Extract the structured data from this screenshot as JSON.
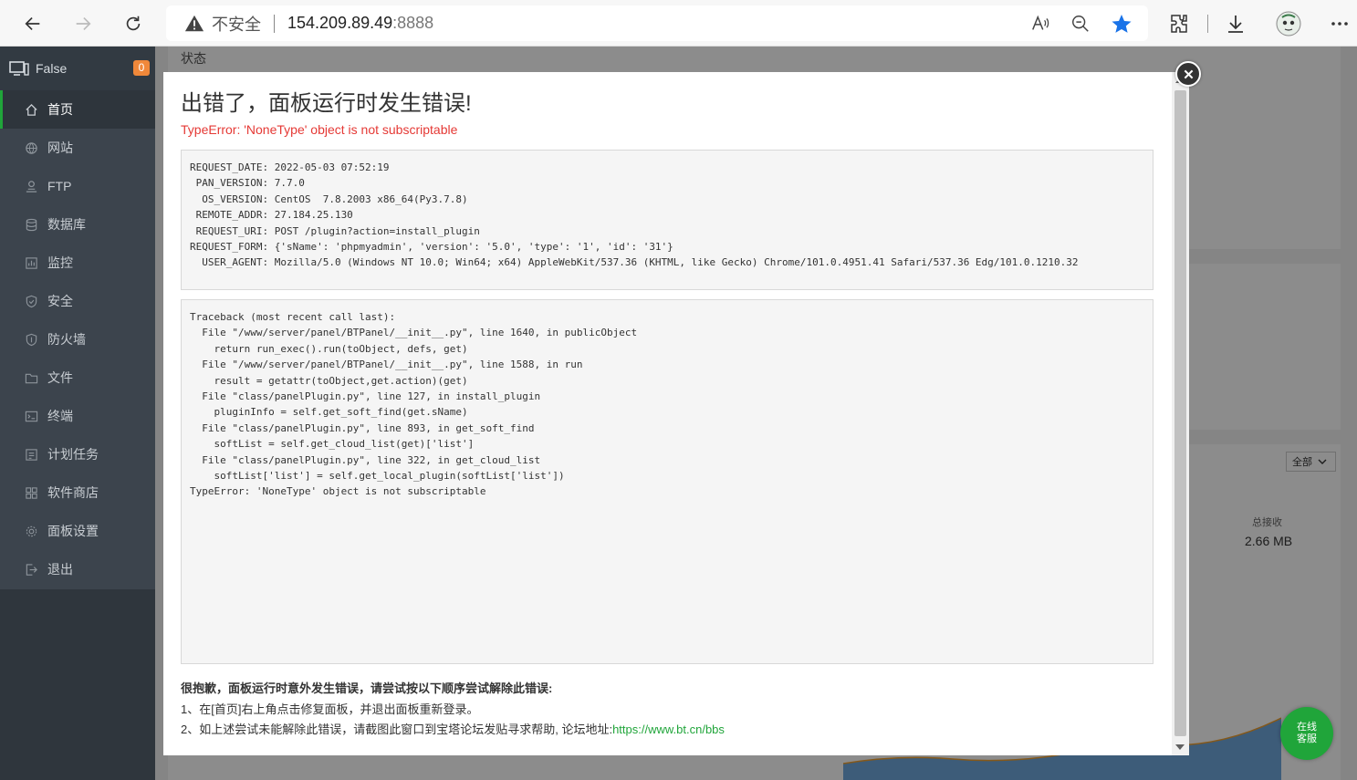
{
  "browser": {
    "security_label": "不安全",
    "url_host": "154.209.89.49",
    "url_port": ":8888"
  },
  "sidebar": {
    "server_name": "False",
    "badge_count": "0",
    "items": [
      {
        "label": "首页",
        "icon": "home-icon"
      },
      {
        "label": "网站",
        "icon": "globe-icon"
      },
      {
        "label": "FTP",
        "icon": "ftp-icon"
      },
      {
        "label": "数据库",
        "icon": "database-icon"
      },
      {
        "label": "监控",
        "icon": "monitor-icon"
      },
      {
        "label": "安全",
        "icon": "shield-icon"
      },
      {
        "label": "防火墙",
        "icon": "firewall-icon"
      },
      {
        "label": "文件",
        "icon": "folder-icon"
      },
      {
        "label": "终端",
        "icon": "terminal-icon"
      },
      {
        "label": "计划任务",
        "icon": "schedule-icon"
      },
      {
        "label": "软件商店",
        "icon": "store-icon"
      },
      {
        "label": "面板设置",
        "icon": "settings-icon"
      },
      {
        "label": "退出",
        "icon": "logout-icon"
      }
    ]
  },
  "background": {
    "status_label": "状态",
    "select_value": "全部",
    "total_received_label": "总接收",
    "total_received_value": "2.66 MB"
  },
  "modal": {
    "title": "出错了，面板运行时发生错误!",
    "error_message": "TypeError: 'NoneType' object is not subscriptable",
    "request_info": "REQUEST_DATE: 2022-05-03 07:52:19\n PAN_VERSION: 7.7.0\n  OS_VERSION: CentOS  7.8.2003 x86_64(Py3.7.8)\n REMOTE_ADDR: 27.184.25.130\n REQUEST_URI: POST /plugin?action=install_plugin\nREQUEST_FORM: {'sName': 'phpmyadmin', 'version': '5.0', 'type': '1', 'id': '31'}\n  USER_AGENT: Mozilla/5.0 (Windows NT 10.0; Win64; x64) AppleWebKit/537.36 (KHTML, like Gecko) Chrome/101.0.4951.41 Safari/537.36 Edg/101.0.1210.32",
    "traceback": "Traceback (most recent call last):\n  File \"/www/server/panel/BTPanel/__init__.py\", line 1640, in publicObject\n    return run_exec().run(toObject, defs, get)\n  File \"/www/server/panel/BTPanel/__init__.py\", line 1588, in run\n    result = getattr(toObject,get.action)(get)\n  File \"class/panelPlugin.py\", line 127, in install_plugin\n    pluginInfo = self.get_soft_find(get.sName)\n  File \"class/panelPlugin.py\", line 893, in get_soft_find\n    softList = self.get_cloud_list(get)['list']\n  File \"class/panelPlugin.py\", line 322, in get_cloud_list\n    softList['list'] = self.get_local_plugin(softList['list'])\nTypeError: 'NoneType' object is not subscriptable",
    "help_title": "很抱歉，面板运行时意外发生错误，请尝试按以下顺序尝试解除此错误:",
    "help_step1": "1、在[首页]右上角点击修复面板，并退出面板重新登录。",
    "help_step2_prefix": "2、如上述尝试未能解除此错误，请截图此窗口到宝塔论坛发贴寻求帮助, 论坛地址:",
    "help_link": "https://www.bt.cn/bbs"
  },
  "chat": {
    "line1": "在线",
    "line2": "客服"
  }
}
